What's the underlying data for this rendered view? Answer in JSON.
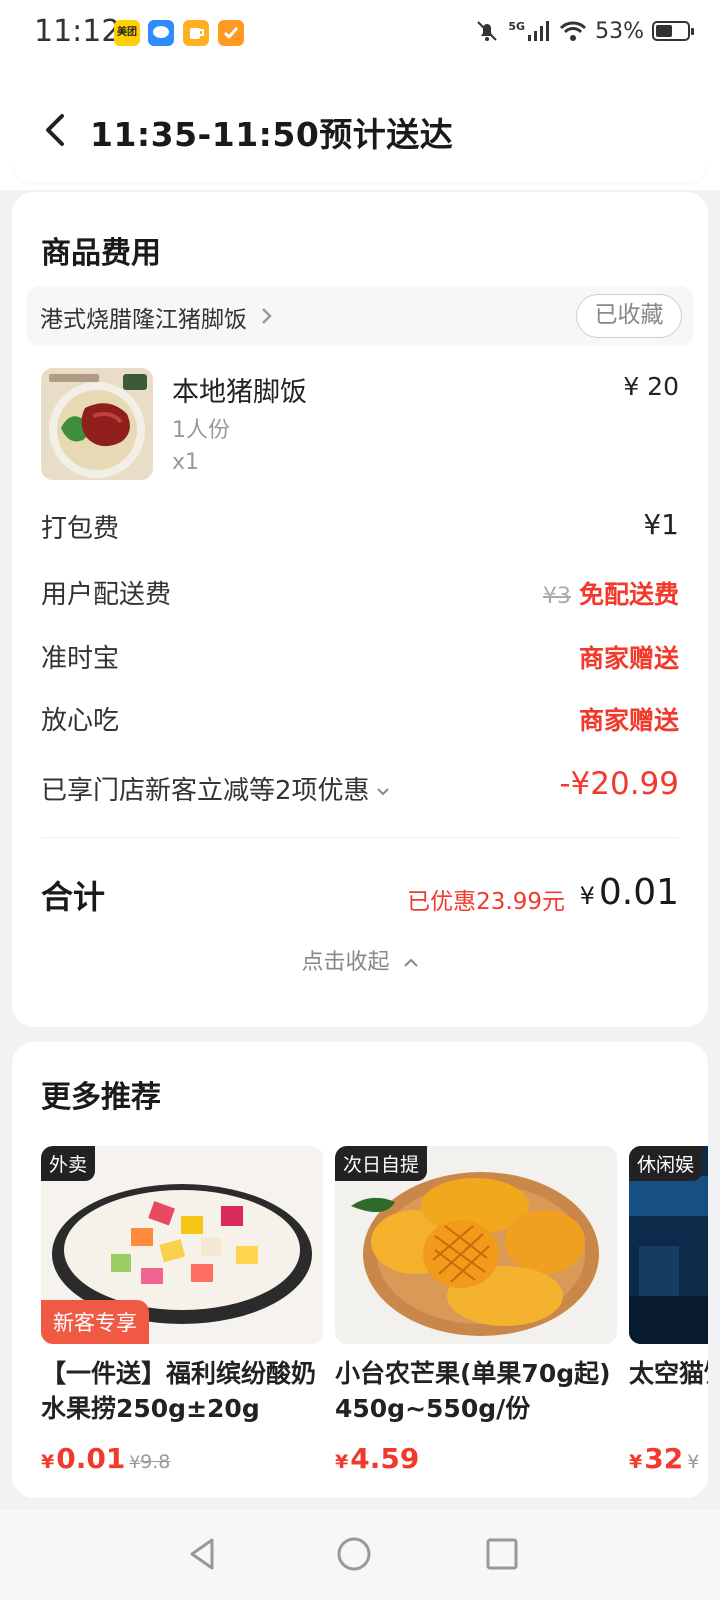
{
  "status_bar": {
    "time": "11:12",
    "apps": [
      {
        "icon": "meituan-app-icon",
        "label": "美团",
        "color": "#ffd000"
      },
      {
        "icon": "message-app-icon",
        "label": "",
        "color": "#2d8cff"
      },
      {
        "icon": "cup-app-icon",
        "label": "",
        "color": "#ffb020"
      },
      {
        "icon": "check-app-icon",
        "label": "",
        "color": "#ff9a20"
      }
    ],
    "network": "5G",
    "battery_percent": "53%",
    "battery_level": 0.53
  },
  "header": {
    "back_icon": "back-arrow-icon",
    "title": "11:35-11:50预计送达"
  },
  "fee_card": {
    "title": "商品费用",
    "store_name": "港式烧腊隆江猪脚饭",
    "favorite_label": "已收藏",
    "dish": {
      "name": "本地猪脚饭",
      "spec": "1人份",
      "qty": "x1",
      "price": "¥ 20"
    },
    "packing_label": "打包费",
    "packing_value": "¥1",
    "delivery_label": "用户配送费",
    "delivery_original": "¥3",
    "delivery_value": "免配送费",
    "ontime_label": "准时宝",
    "ontime_value": "商家赠送",
    "safe_label": "放心吃",
    "safe_value": "商家赠送",
    "discount_label": "已享门店新客立减等2项优惠",
    "discount_value": "-¥20.99",
    "total_label": "合计",
    "total_discount": "已优惠23.99元",
    "total_yen": "¥",
    "total_value": "0.01",
    "collapse_label": "点击收起"
  },
  "recommend": {
    "title": "更多推荐",
    "items": [
      {
        "tag": "外卖",
        "badge": "新客专享",
        "name": "【一件送】福利缤纷酸奶水果捞250g±20g",
        "yen": "¥",
        "price": "0.01",
        "orig_yen": "¥",
        "orig": "9.8"
      },
      {
        "tag": "次日自提",
        "badge": "",
        "name": "小台农芒果(单果70g起) 450g~550g/份",
        "yen": "¥",
        "price": "4.59",
        "orig_yen": "",
        "orig": ""
      },
      {
        "tag": "休闲娱",
        "badge": "",
        "name": "太空猫饮品",
        "yen": "¥",
        "price": "32",
        "orig_yen": "¥",
        "orig": ""
      }
    ]
  },
  "nav": {
    "back": "nav-back-icon",
    "home": "nav-home-icon",
    "recents": "nav-recents-icon"
  }
}
